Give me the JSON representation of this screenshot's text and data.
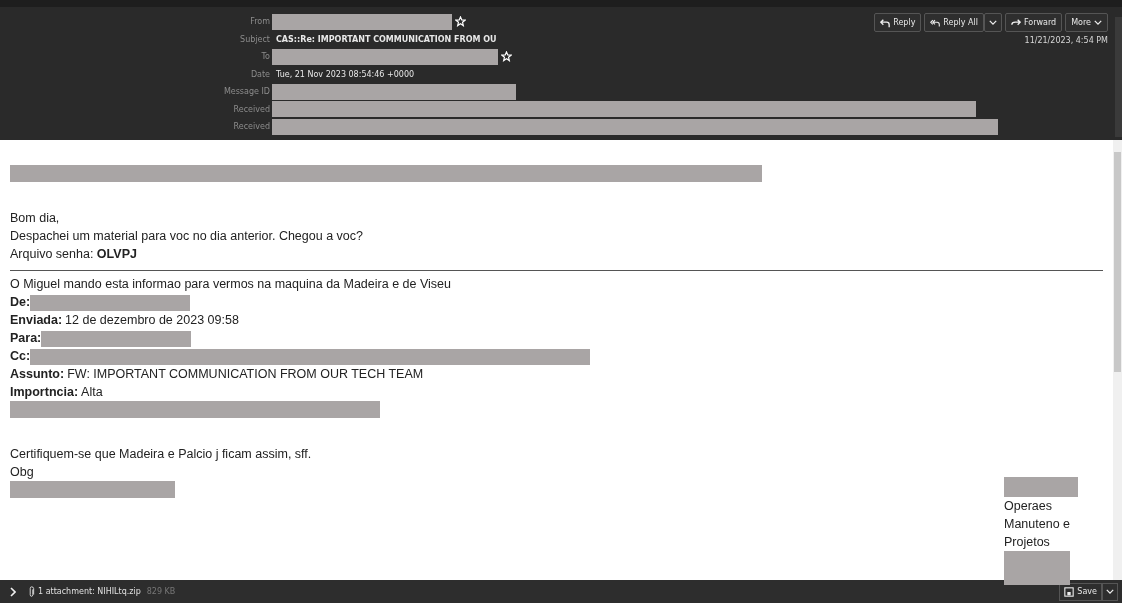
{
  "header": {
    "fields": [
      {
        "label": "From",
        "redacted": true,
        "star": true
      },
      {
        "label": "Subject",
        "value": "CAS::Re: IMPORTANT COMMUNICATION FROM OU",
        "redacted": false,
        "star": false,
        "kind": "subject"
      },
      {
        "label": "To",
        "redacted": true,
        "star": true
      },
      {
        "label": "Date",
        "value": "Tue, 21 Nov 2023 08:54:46 +0000",
        "redacted": false,
        "star": false
      },
      {
        "label": "Message ID",
        "redacted": true,
        "star": false
      },
      {
        "label": "Received",
        "redacted": true,
        "star": false
      },
      {
        "label": "Received",
        "redacted": true,
        "star": false
      }
    ],
    "actions": [
      {
        "label": "Reply",
        "kind": "reply",
        "menu": false
      },
      {
        "label": "Reply All",
        "kind": "reply-all",
        "menu": true
      },
      {
        "label": "Forward",
        "kind": "forward",
        "menu": false
      },
      {
        "label": "More",
        "kind": "more",
        "menu": false
      }
    ],
    "date": "11/21/2023, 4:54 PM"
  },
  "body": [
    {
      "kind": "redacted"
    },
    {
      "kind": "text",
      "text": "Bom dia,"
    },
    {
      "kind": "text",
      "text": "Despachei um material para voc no dia anterior. Chegou a voc?"
    },
    {
      "kind": "text",
      "text": "Arquivo senha: **OLVPJ**"
    },
    {
      "kind": "rule"
    },
    {
      "kind": "text",
      "text": "O Miguel mando esta informao para vermos na maquina da Madeira e de Viseu"
    },
    {
      "kind": "field",
      "label": "De:",
      "redacted": true
    },
    {
      "kind": "field",
      "label": "Enviada:",
      "value": "12 de dezembro de 2023 09:58",
      "redacted": false
    },
    {
      "kind": "field",
      "label": "Para:",
      "redacted": true
    },
    {
      "kind": "field",
      "label": "Cc:",
      "redacted": true
    },
    {
      "kind": "field",
      "label": "Assunto:",
      "value": "FW: IMPORTANT COMMUNICATION FROM OUR TECH TEAM",
      "redacted": false
    },
    {
      "kind": "field",
      "label": "Importncia:",
      "value": "Alta",
      "redacted": false
    },
    {
      "kind": "redacted"
    },
    {
      "kind": "text",
      "text": "Certifiquem-se que Madeira e Palcio j ficam assim, sff."
    },
    {
      "kind": "text",
      "text": "Obg"
    },
    {
      "kind": "redacted"
    }
  ],
  "signature": [
    {
      "kind": "redacted"
    },
    {
      "kind": "text",
      "text": "Operaes"
    },
    {
      "kind": "text",
      "text": "Manuteno e"
    },
    {
      "kind": "text",
      "text": "Projetos"
    },
    {
      "kind": "redacted"
    }
  ],
  "footer": {
    "attachment": "1 attachment: NIHILtq.zip",
    "size": "829 KB",
    "save": "Save"
  }
}
